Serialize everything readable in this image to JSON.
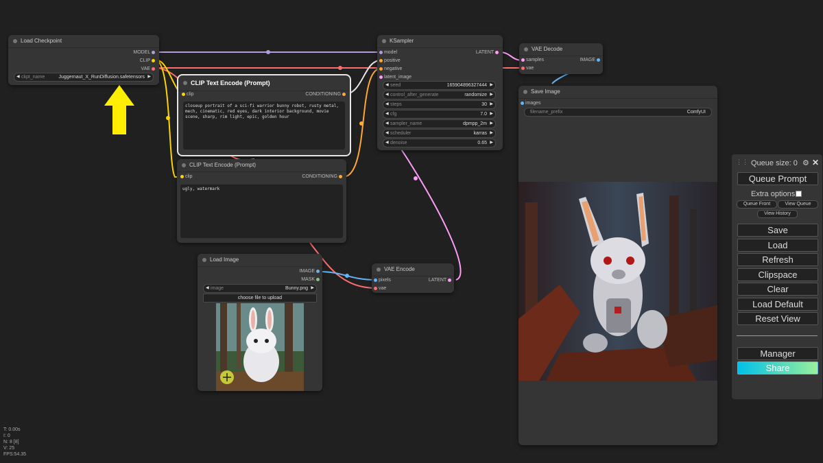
{
  "load_checkpoint": {
    "title": "Load Checkpoint",
    "outputs": [
      "MODEL",
      "CLIP",
      "VAE"
    ],
    "widget_label": "ckpt_name",
    "widget_value": "Juggernaut_X_RunDiffusion.safetensors"
  },
  "clip_pos": {
    "title": "CLIP Text Encode (Prompt)",
    "input": "clip",
    "output": "CONDITIONING",
    "text": "closeup portrait of a sci-fi warrior bunny robot, rusty metal, mech, cinematic, red eyes, dark interior background, movie scene, sharp, rim light, epic, golden hour"
  },
  "clip_neg": {
    "title": "CLIP Text Encode (Prompt)",
    "input": "clip",
    "output": "CONDITIONING",
    "text": "ugly, watermark"
  },
  "ksampler": {
    "title": "KSampler",
    "inputs": [
      "model",
      "positive",
      "negative",
      "latent_image"
    ],
    "output": "LATENT",
    "widgets": [
      {
        "label": "seed",
        "value": "165904896327444"
      },
      {
        "label": "control_after_generate",
        "value": "randomize"
      },
      {
        "label": "steps",
        "value": "30"
      },
      {
        "label": "cfg",
        "value": "7.0"
      },
      {
        "label": "sampler_name",
        "value": "dpmpp_2m"
      },
      {
        "label": "scheduler",
        "value": "karras"
      },
      {
        "label": "denoise",
        "value": "0.65"
      }
    ]
  },
  "vae_decode": {
    "title": "VAE Decode",
    "inputs": [
      "samples",
      "vae"
    ],
    "output": "IMAGE"
  },
  "save_image": {
    "title": "Save Image",
    "input": "images",
    "widget_label": "filename_prefix",
    "widget_value": "ComfyUI"
  },
  "load_image": {
    "title": "Load Image",
    "outputs": [
      "IMAGE",
      "MASK"
    ],
    "widget_label": "image",
    "widget_value": "Bunny.png",
    "upload_label": "choose file to upload"
  },
  "vae_encode": {
    "title": "VAE Encode",
    "inputs": [
      "pixels",
      "vae"
    ],
    "output": "LATENT"
  },
  "queue_panel": {
    "queue_size": "Queue size: 0",
    "queue_prompt": "Queue Prompt",
    "extra_options": "Extra options",
    "queue_front": "Queue Front",
    "view_queue": "View Queue",
    "view_history": "View History",
    "buttons": [
      "Save",
      "Load",
      "Refresh",
      "Clipspace",
      "Clear",
      "Load Default",
      "Reset View"
    ],
    "manager": "Manager",
    "share": "Share"
  },
  "stats": [
    "T: 0.00s",
    "I: 0",
    "N: 8 [8]",
    "V: 25",
    "FPS:54.35"
  ],
  "colors": {
    "model": "#b39ddb",
    "clip": "#ffd500",
    "vae": "#ff6e6e",
    "conditioning": "#ffa931",
    "latent": "#ff9cf9",
    "image": "#64b5f6",
    "mask": "#81c784",
    "accent_arrow": "#ffee00"
  }
}
